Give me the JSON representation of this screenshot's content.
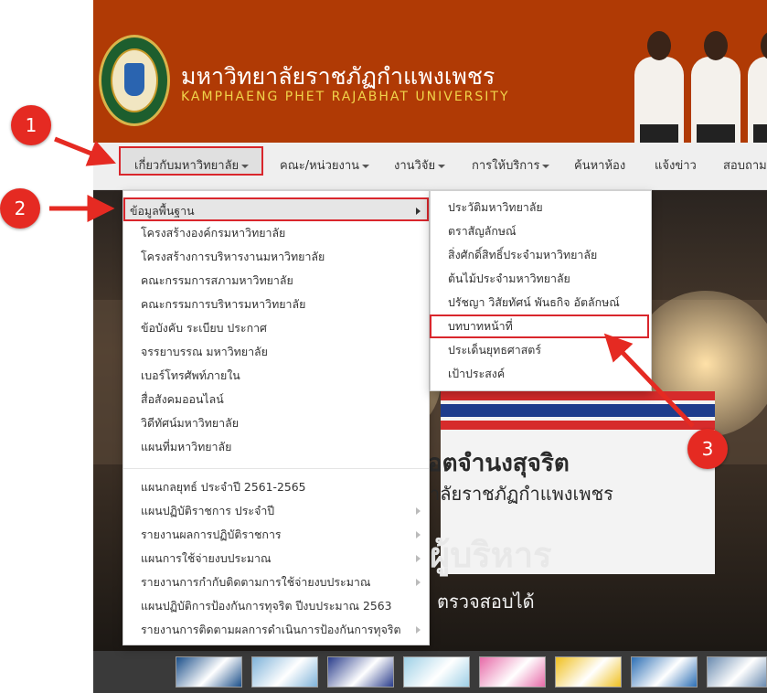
{
  "header": {
    "title_th": "มหาวิทยาลัยราชภัฏกำแพงเพชร",
    "title_en": "KAMPHAENG PHET RAJABHAT UNIVERSITY",
    "brand_color": "#b03a05",
    "subtitle_color": "#f0d34a"
  },
  "nav": {
    "items": [
      {
        "label": "เกี่ยวกับมหาวิทยาลัย",
        "has_caret": true,
        "active": true
      },
      {
        "label": "คณะ/หน่วยงาน",
        "has_caret": true
      },
      {
        "label": "งานวิจัย",
        "has_caret": true
      },
      {
        "label": "การให้บริการ",
        "has_caret": true
      },
      {
        "label": "ค้นหาห้อง",
        "has_caret": false
      },
      {
        "label": "แจ้งข่าว",
        "has_caret": false
      },
      {
        "label": "สอบถาม",
        "has_caret": false
      }
    ]
  },
  "menu1": {
    "items": [
      {
        "label": "ข้อมูลพื้นฐาน",
        "submenu": true,
        "highlighted": true
      },
      {
        "label": "โครงสร้างองค์กรมหาวิทยาลัย"
      },
      {
        "label": "โครงสร้างการบริหารงานมหาวิทยาลัย"
      },
      {
        "label": "คณะกรรมการสภามหาวิทยาลัย"
      },
      {
        "label": "คณะกรรมการบริหารมหาวิทยาลัย"
      },
      {
        "label": "ข้อบังคับ ระเบียบ ประกาศ"
      },
      {
        "label": "จรรยาบรรณ มหาวิทยาลัย"
      },
      {
        "label": "เบอร์โทรศัพท์ภายใน"
      },
      {
        "label": "สื่อสังคมออนไลน์"
      },
      {
        "label": "วิดีทัศน์มหาวิทยาลัย"
      },
      {
        "label": "แผนที่มหาวิทยาลัย"
      },
      {
        "label": "แผนกลยุทธ์ ประจำปี 2561-2565"
      },
      {
        "label": "แผนปฏิบัติราชการ ประจำปี",
        "submenu": true
      },
      {
        "label": "รายงานผลการปฏิบัติราชการ",
        "submenu": true
      },
      {
        "label": "แผนการใช้จ่ายงบประมาณ",
        "submenu": true
      },
      {
        "label": "รายงานการกำกับติดตามการใช้จ่ายงบประมาณ",
        "submenu": true
      },
      {
        "label": "แผนปฏิบัติการป้องกันการทุจริต ปีงบประมาณ 2563"
      },
      {
        "label": "รายงานการติดตามผลการดำเนินการป้องกันการทุจริต",
        "submenu": true
      }
    ]
  },
  "menu2": {
    "items": [
      {
        "label": "ประวัติมหาวิทยาลัย"
      },
      {
        "label": "ตราสัญลักษณ์"
      },
      {
        "label": "สิ่งศักดิ์สิทธิ์ประจำมหาวิทยาลัย"
      },
      {
        "label": "ต้นไม้ประจำมหาวิทยาลัย"
      },
      {
        "label": "ปรัชญา วิสัยทัศน์ พันธกิจ อัตลักษณ์"
      },
      {
        "label": "บทบาทหน้าที่",
        "boxed": true
      },
      {
        "label": "ประเด็นยุทธศาสตร์"
      },
      {
        "label": "เป้าประสงค์"
      }
    ]
  },
  "hero": {
    "line1": "อตจำนงสุจริต",
    "line2": "าลัยราชภัฏกำแพงเพชร",
    "line3": "ผู้บริหาร",
    "line4": "ตรวจสอบได้"
  },
  "annotations": {
    "badges": [
      "1",
      "2",
      "3"
    ],
    "color": "#e52a22"
  },
  "thumbnails": {
    "colors": [
      "#1b4f8a",
      "#7fb3d9",
      "#2a3d8c",
      "#9ed0e6",
      "#e76aa8",
      "#f0c020",
      "#2d6fb5",
      "#6a8bb0"
    ]
  }
}
